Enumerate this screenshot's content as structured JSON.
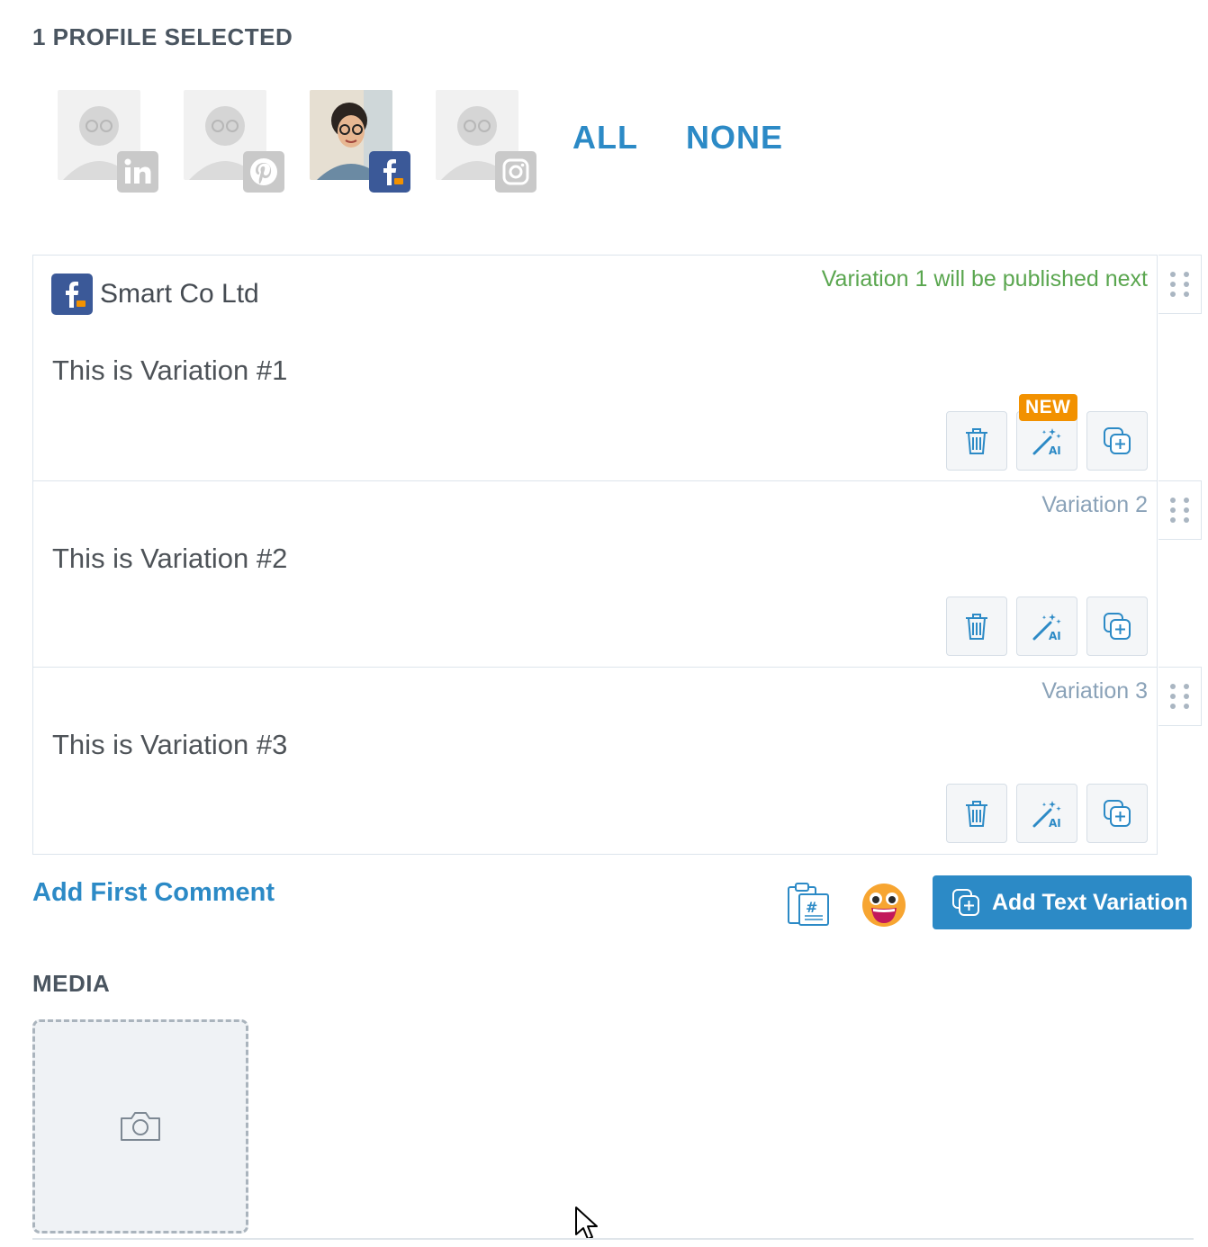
{
  "header": {
    "profiles_selected": "1 PROFILE SELECTED",
    "select_all": "ALL",
    "select_none": "NONE"
  },
  "profiles": [
    {
      "network": "LinkedIn",
      "selected": false,
      "icon": "linkedin-icon"
    },
    {
      "network": "Pinterest",
      "selected": false,
      "icon": "pinterest-icon"
    },
    {
      "network": "Facebook",
      "selected": true,
      "icon": "facebook-icon"
    },
    {
      "network": "Instagram",
      "selected": false,
      "icon": "instagram-icon"
    }
  ],
  "profile_name": "Smart Co Ltd",
  "variations": [
    {
      "status": "Variation 1 will be published next",
      "text": "This is Variation #1",
      "ai_new_badge": "NEW"
    },
    {
      "status": "Variation 2",
      "text": "This is Variation #2"
    },
    {
      "status": "Variation 3",
      "text": "This is Variation #3"
    }
  ],
  "actions": {
    "add_first_comment": "Add First Comment",
    "add_text_variation": "Add Text Variation"
  },
  "media": {
    "heading": "MEDIA"
  },
  "colors": {
    "accent": "#2c8ac6",
    "facebook": "#3b5998",
    "next_status": "#5aa64f",
    "new_badge": "#f29100"
  }
}
